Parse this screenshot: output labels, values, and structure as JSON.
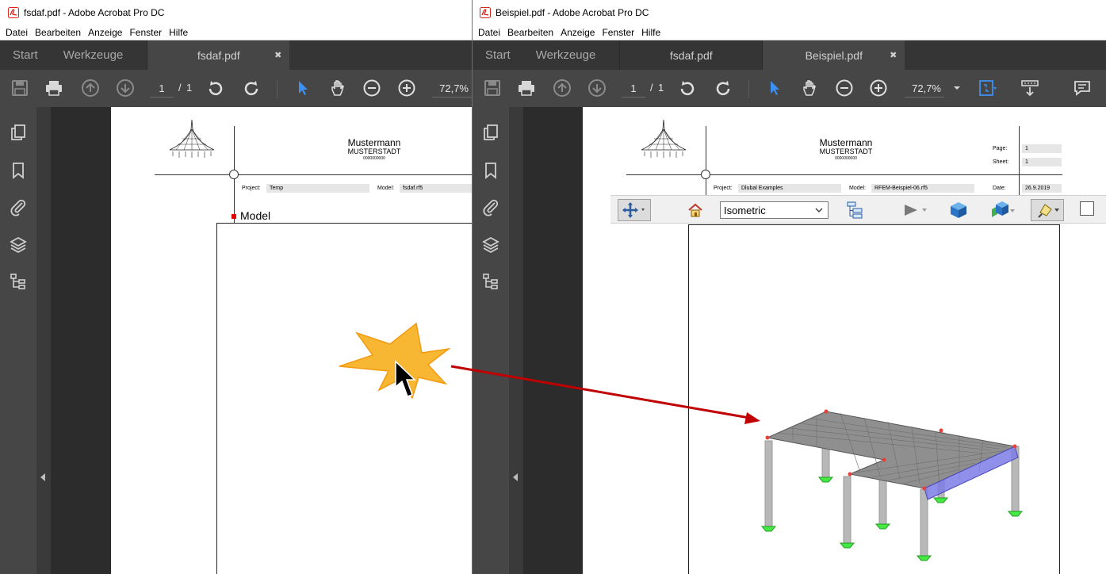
{
  "colors": {
    "accent": "#2f7bd2",
    "acrobat_red": "#d9261c",
    "dark_chrome": "#464646",
    "tab_bar": "#353535",
    "arrow": "#c00000",
    "starburst": "#f7b733"
  },
  "left_window": {
    "title": "fsdaf.pdf - Adobe Acrobat Pro DC",
    "menu": [
      "Datei",
      "Bearbeiten",
      "Anzeige",
      "Fenster",
      "Hilfe"
    ],
    "tabs": {
      "start": "Start",
      "tools": "Werkzeuge",
      "doc": "fsdaf.pdf"
    },
    "page": {
      "current": "1",
      "separator": "/",
      "total": "1"
    },
    "zoom": "72,7%",
    "sidebar_icons": [
      "pages-icon",
      "bookmark-icon",
      "attachment-icon",
      "layers-icon",
      "model-tree-icon"
    ],
    "document": {
      "company": "Mustermann",
      "city": "MUSTERSTADT",
      "code": "0000000000",
      "project_label": "Project:",
      "project_value": "Temp",
      "model_label": "Model:",
      "model_value": "fsdaf.rf5",
      "section_title": "Model"
    }
  },
  "right_window": {
    "title": "Beispiel.pdf - Adobe Acrobat Pro DC",
    "menu": [
      "Datei",
      "Bearbeiten",
      "Anzeige",
      "Fenster",
      "Hilfe"
    ],
    "tabs": {
      "start": "Start",
      "tools": "Werkzeuge",
      "doc1": "fsdaf.pdf",
      "doc2": "Beispiel.pdf"
    },
    "page": {
      "current": "1",
      "separator": "/",
      "total": "1"
    },
    "zoom": "72,7%",
    "document": {
      "company": "Mustermann",
      "city": "MUSTERSTADT",
      "code": "0000000000",
      "page_label": "Page:",
      "page_value": "1",
      "sheet_label": "Sheet:",
      "sheet_value": "1",
      "project_label": "Project:",
      "project_value": "Dlubal Examples",
      "model_label": "Model:",
      "model_value": "RFEM-Beispiel-06.rf5",
      "date_label": "Date:",
      "date_value": "26.9.2019"
    },
    "viewer3d_toolbar": {
      "view_dropdown": "Isometric"
    }
  },
  "annotation": {
    "pointer": "cursor-arrow-icon",
    "effect": "click-starburst",
    "connector": "red-arrow"
  }
}
